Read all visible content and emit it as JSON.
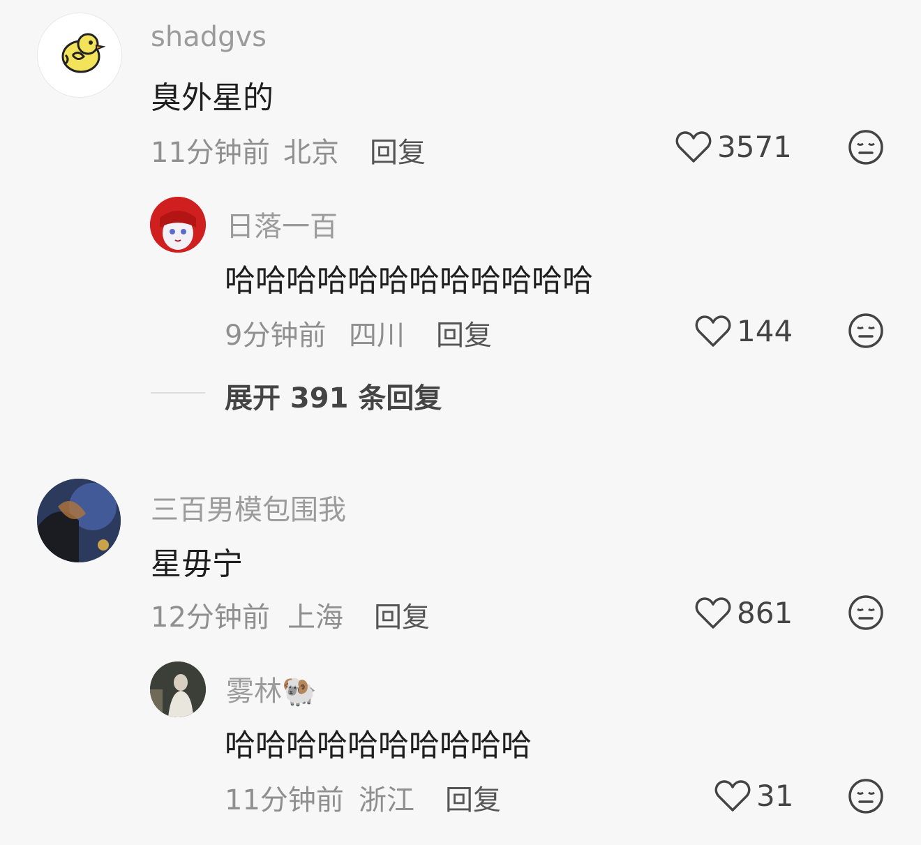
{
  "comments": [
    {
      "username": "shadgvs",
      "text": "臭外星的",
      "time": "11分钟前",
      "location": "北京",
      "reply_label": "回复",
      "likes": "3571",
      "replies": [
        {
          "username": "日落一百",
          "text": "哈哈哈哈哈哈哈哈哈哈哈哈",
          "time": "9分钟前",
          "location": "四川",
          "reply_label": "回复",
          "likes": "144"
        }
      ],
      "expand_label": "展开 391 条回复"
    },
    {
      "username": "三百男模包围我",
      "text": "星毋宁",
      "time": "12分钟前",
      "location": "上海",
      "reply_label": "回复",
      "likes": "861",
      "replies": [
        {
          "username": "雾林🐏",
          "text": "哈哈哈哈哈哈哈哈哈哈",
          "time": "11分钟前",
          "location": "浙江",
          "reply_label": "回复",
          "likes": "31"
        }
      ]
    }
  ],
  "icons": {
    "like": "heart-outline-icon",
    "dislike": "meh-face-icon",
    "avatar1": "yellow-chick",
    "sheep": "sheep-emoji"
  },
  "colors": {
    "background": "#f7f7f7",
    "username": "#9b9b9b",
    "text": "#1e1e1e",
    "meta": "#8f8f8f"
  }
}
